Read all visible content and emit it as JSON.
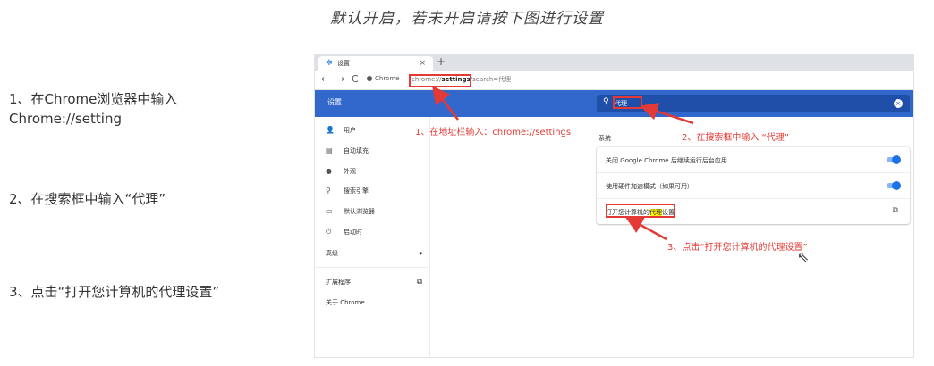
{
  "top_caption": "默认开启，若未开启请按下图进行设置",
  "steps": [
    {
      "line1": "1、在Chrome浏览器中输入",
      "line2": "Chrome://setting"
    },
    {
      "line1": "2、在搜索框中输入“代理”"
    },
    {
      "line1": "3、点击“打开您计算机的代理设置”"
    }
  ],
  "browser": {
    "tab_title": "设置",
    "tab_close": "×",
    "new_tab": "+",
    "nav": {
      "back": "←",
      "forward": "→",
      "reload": "C"
    },
    "site_chip": "Chrome",
    "url_prefix": "chrome://",
    "url_bold": "settings",
    "url_rest": "/search=代理",
    "header_title": "设置",
    "search_value": "代理",
    "sidebar": [
      {
        "icon": "person-icon",
        "glyph": "👤",
        "label": "用户"
      },
      {
        "icon": "clipboard-icon",
        "glyph": "▤",
        "label": "自动填充"
      },
      {
        "icon": "palette-icon",
        "glyph": "●",
        "label": "外观"
      },
      {
        "icon": "search-icon",
        "glyph": "⚲",
        "label": "搜索引擎"
      },
      {
        "icon": "browser-icon",
        "glyph": "▭",
        "label": "默认浏览器"
      },
      {
        "icon": "power-icon",
        "glyph": "⏻",
        "label": "启动时"
      }
    ],
    "advanced": "高级",
    "advanced_chevron": "▾",
    "extensions": "扩展程序",
    "about": "关于 Chrome",
    "section_label": "系统",
    "rows": [
      "关闭 Google Chrome 后继续运行后台应用",
      "使用硬件加速模式（如果可用）"
    ],
    "proxy_row": {
      "pre": "打开您计算机的",
      "highlight": "代理",
      "post": "设置"
    }
  },
  "annotations": [
    "1、在地址栏输入：chrome://settings",
    "2、在搜索框中输入 “代理”",
    "3、点击“打开您计算机的代理设置”"
  ],
  "colors": {
    "accent": "#3268cc",
    "annotation_red": "#e53935",
    "highlight": "#fff200"
  }
}
